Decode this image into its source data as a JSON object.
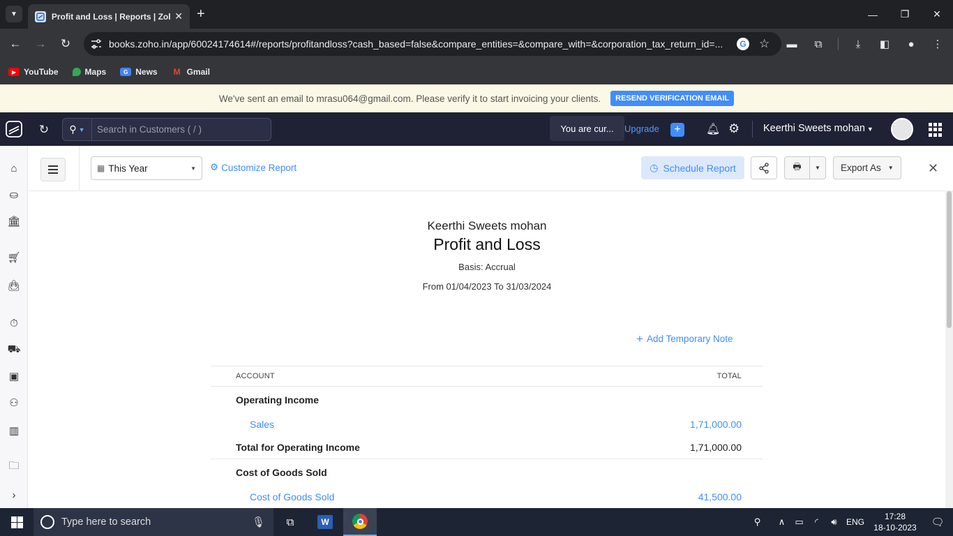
{
  "browser": {
    "tab_title": "Profit and Loss | Reports | Zoho",
    "url": "books.zoho.in/app/60024174614#/reports/profitandloss?cash_based=false&compare_entities=&compare_with=&corporation_tax_return_id=...",
    "bookmarks": [
      {
        "label": "YouTube",
        "icon": "youtube-icon",
        "color": "#ff0000"
      },
      {
        "label": "Maps",
        "icon": "maps-icon",
        "color": "#34a853"
      },
      {
        "label": "News",
        "icon": "news-icon",
        "color": "#4285f4"
      },
      {
        "label": "Gmail",
        "icon": "gmail-icon",
        "color": "#ea4335"
      }
    ]
  },
  "banner": {
    "message": "We've sent an email to mrasu064@gmail.com. Please verify it to start invoicing your clients.",
    "button": "RESEND VERIFICATION EMAIL"
  },
  "appbar": {
    "search_placeholder": "Search in Customers ( / )",
    "trial_text": "You are cur...",
    "upgrade": "Upgrade",
    "org_name": "Keerthi Sweets mohan"
  },
  "report_toolbar": {
    "period": "This Year",
    "customize": "Customize Report",
    "schedule": "Schedule Report",
    "export": "Export As"
  },
  "report": {
    "org": "Keerthi Sweets mohan",
    "title": "Profit and Loss",
    "basis": "Basis: Accrual",
    "range": "From 01/04/2023 To 31/03/2024",
    "add_note": "Add Temporary Note",
    "columns": {
      "account": "ACCOUNT",
      "total": "TOTAL"
    },
    "rows": [
      {
        "kind": "group",
        "label": "Operating Income",
        "value": ""
      },
      {
        "kind": "item",
        "label": "Sales",
        "value": "1,71,000.00"
      },
      {
        "kind": "total",
        "label": "Total for Operating Income",
        "value": "1,71,000.00"
      },
      {
        "kind": "group",
        "label": "Cost of Goods Sold",
        "value": ""
      },
      {
        "kind": "item",
        "label": "Cost of Goods Sold",
        "value": "41,500.00"
      }
    ]
  },
  "taskbar": {
    "search_placeholder": "Type here to search",
    "language": "ENG",
    "time": "17:28",
    "date": "18-10-2023"
  },
  "colors": {
    "accent": "#408dfb",
    "appbar": "#1f2235",
    "banner": "#fcf8e6"
  }
}
